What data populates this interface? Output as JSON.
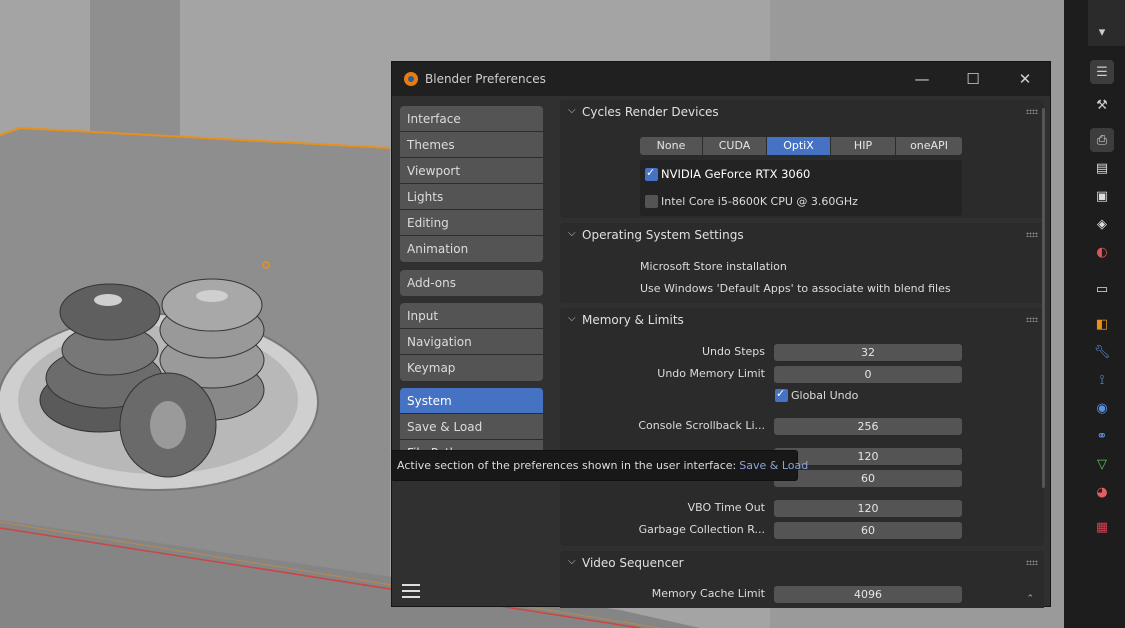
{
  "window": {
    "title": "Blender Preferences",
    "minimize_glyph": "—",
    "maximize_glyph": "☐",
    "close_glyph": "✕"
  },
  "sidebar": {
    "groups": [
      [
        "Interface",
        "Themes",
        "Viewport",
        "Lights",
        "Editing",
        "Animation"
      ],
      [
        "Add-ons"
      ],
      [
        "Input",
        "Navigation",
        "Keymap"
      ],
      [
        "System",
        "Save & Load",
        "File Paths"
      ]
    ],
    "active": "System"
  },
  "cycles": {
    "title": "Cycles Render Devices",
    "devices": [
      "None",
      "CUDA",
      "OptiX",
      "HIP",
      "oneAPI"
    ],
    "active_device": "OptiX",
    "gpu": {
      "label": "NVIDIA GeForce RTX 3060",
      "checked": true
    },
    "cpu": {
      "label": "Intel Core i5-8600K CPU @ 3.60GHz",
      "checked": false
    }
  },
  "os_settings": {
    "title": "Operating System Settings",
    "line1": "Microsoft Store installation",
    "line2": "Use Windows 'Default Apps' to associate with blend files"
  },
  "memory": {
    "title": "Memory & Limits",
    "undo_steps_label": "Undo Steps",
    "undo_steps": "32",
    "undo_memory_label": "Undo Memory Limit",
    "undo_memory": "0",
    "global_undo_label": "Global Undo",
    "global_undo": true,
    "console_label": "Console Scrollback Li...",
    "console": "256",
    "hidden1": "120",
    "hidden2": "60",
    "vbo_label": "VBO Time Out",
    "vbo": "120",
    "gc_label": "Garbage Collection R...",
    "gc": "60"
  },
  "video_sequencer": {
    "title": "Video Sequencer",
    "cache_label": "Memory Cache Limit",
    "cache": "4096"
  },
  "tooltip": {
    "text": "Active section of the preferences shown in the user interface:",
    "value": "Save & Load"
  },
  "colors": {
    "accent": "#4672c4",
    "selection_orange": "#e8901a"
  }
}
